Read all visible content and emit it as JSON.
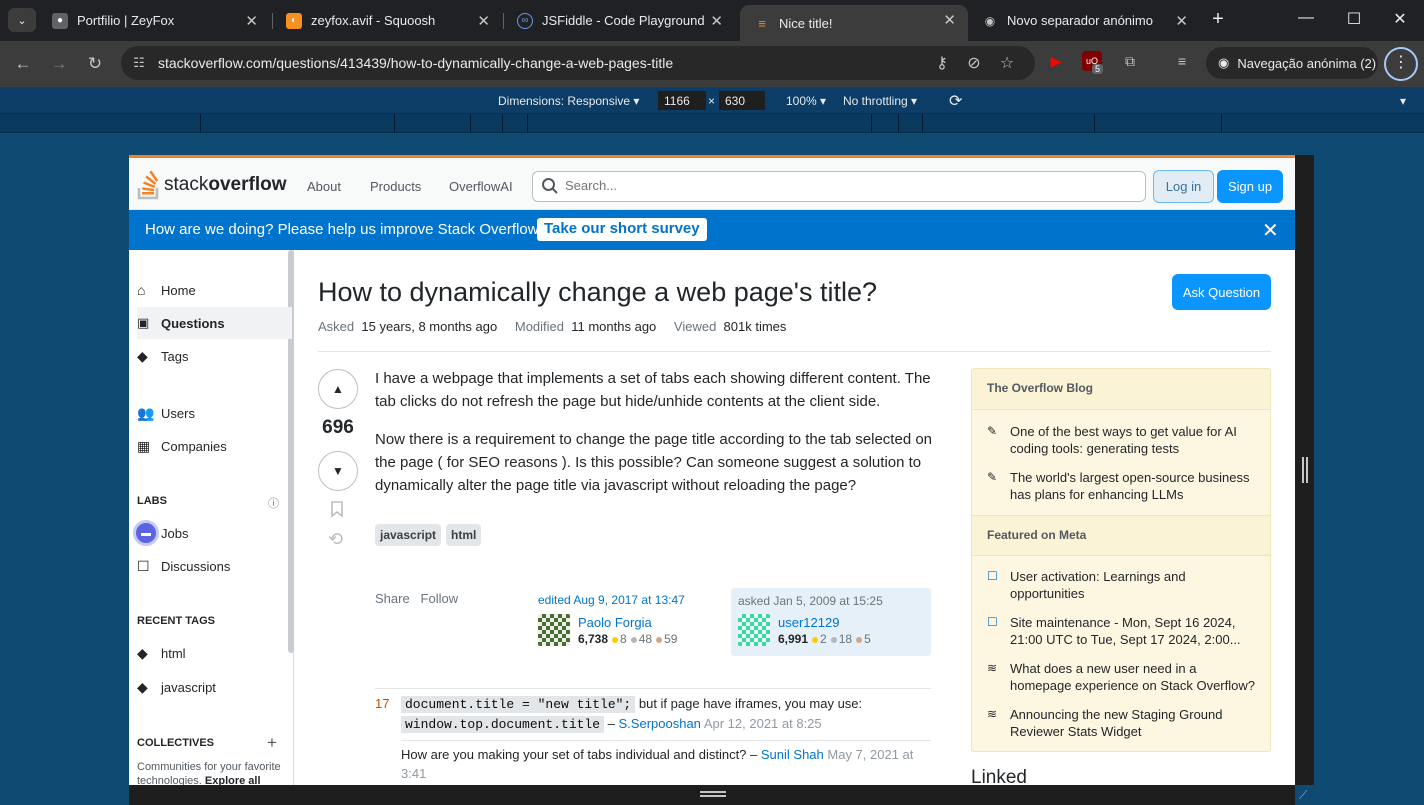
{
  "browser": {
    "tabs": [
      {
        "title": "Portfilio | ZeyFox",
        "icon": "profile-icon"
      },
      {
        "title": "zeyfox.avif - Squoosh",
        "icon": "squoosh-icon"
      },
      {
        "title": "JSFiddle - Code Playground",
        "icon": "jsfiddle-icon"
      },
      {
        "title": "Nice title!",
        "icon": "stackoverflow-icon"
      },
      {
        "title": "Novo separador anónimo",
        "icon": "incognito-icon"
      }
    ],
    "url": "stackoverflow.com/questions/413439/how-to-dynamically-change-a-web-pages-title",
    "incognito_label": "Navegação anónima (2)",
    "extension_badge": "5"
  },
  "devtools": {
    "dimensions_label": "Dimensions: Responsive",
    "width": "1166",
    "times": "×",
    "height": "630",
    "zoom": "100%",
    "throttling": "No throttling"
  },
  "so": {
    "logo_light": "stack",
    "logo_bold": "overflow",
    "nav": [
      "About",
      "Products",
      "OverflowAI"
    ],
    "search_placeholder": "Search...",
    "login": "Log in",
    "signup": "Sign up",
    "survey_text": "How are we doing? Please help us improve Stack Overflow.",
    "survey_btn": "Take our short survey"
  },
  "sidebar": {
    "items": [
      {
        "label": "Home",
        "icon": "home-icon"
      },
      {
        "label": "Questions",
        "icon": "questions-icon"
      },
      {
        "label": "Tags",
        "icon": "tag-icon"
      },
      {
        "label": "Users",
        "icon": "users-icon"
      },
      {
        "label": "Companies",
        "icon": "companies-icon"
      }
    ],
    "labs_heading": "LABS",
    "labs_items": [
      {
        "label": "Jobs",
        "icon": "briefcase-icon"
      },
      {
        "label": "Discussions",
        "icon": "discussions-icon"
      }
    ],
    "recent_tags_heading": "RECENT TAGS",
    "recent_tags": [
      "html",
      "javascript"
    ],
    "collectives_heading": "COLLECTIVES",
    "collectives_text_1": "Communities for your favorite",
    "collectives_text_2": "technologies. ",
    "collectives_link": "Explore all"
  },
  "question": {
    "title": "How to dynamically change a web page's title?",
    "ask_button": "Ask Question",
    "meta": {
      "asked_label": "Asked",
      "asked_value": "15 years, 8 months ago",
      "modified_label": "Modified",
      "modified_value": "11 months ago",
      "viewed_label": "Viewed",
      "viewed_value": "801k times"
    },
    "votes": "696",
    "body_p1": "I have a webpage that implements a set of tabs each showing different content. The tab clicks do not refresh the page but hide/unhide contents at the client side.",
    "body_p2": "Now there is a requirement to change the page title according to the tab selected on the page ( for SEO reasons ). Is this possible? Can someone suggest a solution to dynamically alter the page title via javascript without reloading the page?",
    "tags": [
      "javascript",
      "html"
    ],
    "share": "Share",
    "follow": "Follow",
    "edited": {
      "label": "edited Aug 9, 2017 at 13:47",
      "name": "Paolo Forgia",
      "rep": "6,738",
      "gold": "8",
      "silver": "48",
      "bronze": "59"
    },
    "asked": {
      "label": "asked Jan 5, 2009 at 15:25",
      "name": "user12129",
      "rep": "6,991",
      "gold": "2",
      "silver": "18",
      "bronze": "5"
    }
  },
  "comments": [
    {
      "score": "17",
      "code1": "document.title = \"new title\";",
      "text": " but if page have iframes, you may use:",
      "code2": "window.top.document.title",
      "dash": " – ",
      "user": "S.Serpooshan",
      "date": "Apr 12, 2021 at 8:25"
    },
    {
      "text": "How are you making your set of tabs individual and distinct? – ",
      "user": "Sunil Shah",
      "date": "May 7, 2021 at 3:41"
    }
  ],
  "blog": {
    "heading": "The Overflow Blog",
    "items": [
      "One of the best ways to get value for AI coding tools: generating tests",
      "The world's largest open-source business has plans for enhancing LLMs"
    ],
    "meta_heading": "Featured on Meta",
    "meta_items": [
      "User activation: Learnings and opportunities",
      "Site maintenance - Mon, Sept 16 2024, 21:00 UTC to Tue, Sept 17 2024, 2:00...",
      "What does a new user need in a homepage experience on Stack Overflow?",
      "Announcing the new Staging Ground Reviewer Stats Widget"
    ],
    "linked": "Linked"
  }
}
